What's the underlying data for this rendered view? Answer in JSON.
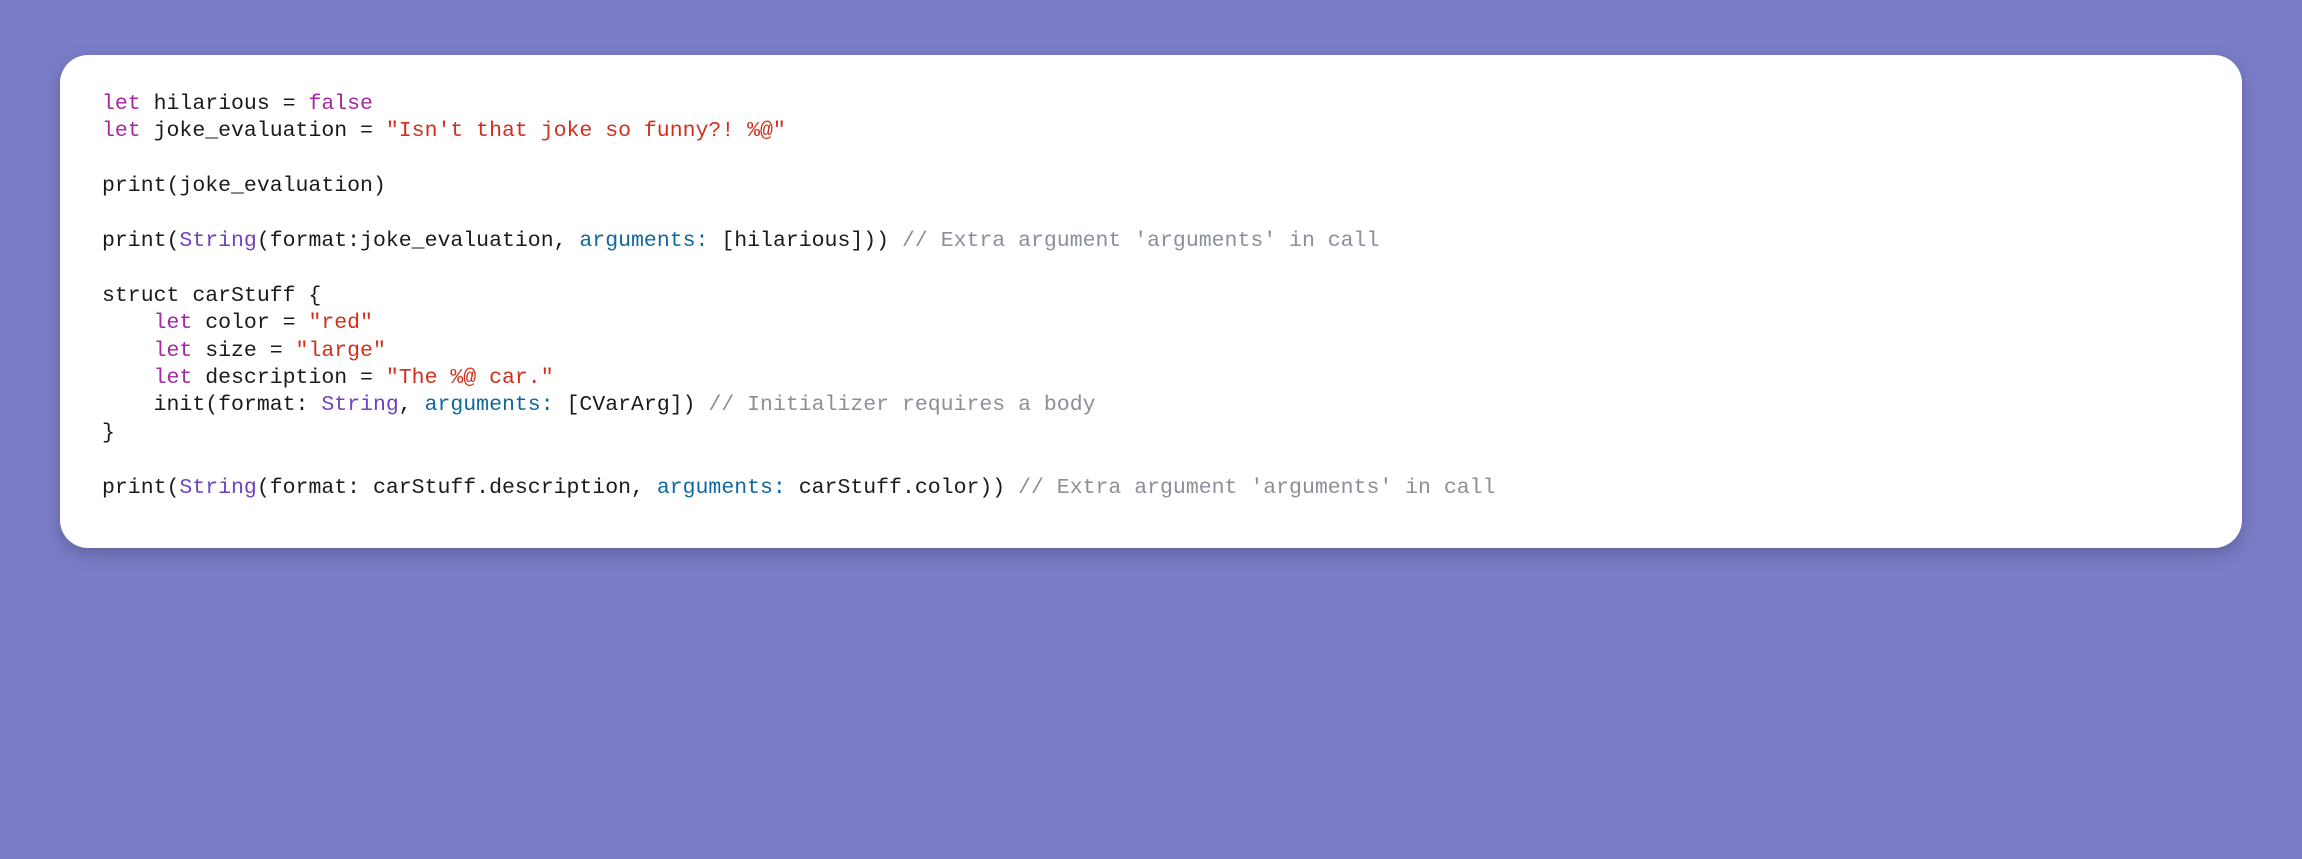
{
  "code": {
    "lines": [
      {
        "t1": "let",
        "t2": " hilarious = ",
        "t3": "false"
      },
      {
        "t1": "let",
        "t2": " joke_evaluation = ",
        "t3": "\"Isn't that joke so funny?! %@\""
      },
      {
        "blank": true
      },
      {
        "t2": "print(joke_evaluation)"
      },
      {
        "blank": true
      },
      {
        "t2a": "print(",
        "t2b": "String",
        "t2c": "(format:joke_evaluation, ",
        "t2d": "arguments:",
        "t2e": " [hilarious])) ",
        "t2f": "// Extra argument 'arguments' in call"
      },
      {
        "blank": true
      },
      {
        "t2": "struct carStuff {"
      },
      {
        "indent": "    ",
        "t1": "let",
        "t2": " color = ",
        "t3": "\"red\""
      },
      {
        "indent": "    ",
        "t1": "let",
        "t2": " size = ",
        "t3": "\"large\""
      },
      {
        "indent": "    ",
        "t1": "let",
        "t2": " description = ",
        "t3": "\"The %@ car.\""
      },
      {
        "indent": "    ",
        "t2a": "init(format: ",
        "t2b": "String",
        "t2c": ", ",
        "t2d": "arguments:",
        "t2e": " [CVarArg]) ",
        "t2f": "// Initializer requires a body"
      },
      {
        "t2": "}"
      },
      {
        "blank": true
      },
      {
        "t2a": "print(",
        "t2b": "String",
        "t2c": "(format: carStuff.description, ",
        "t2d": "arguments:",
        "t2e": " carStuff.color)) ",
        "t2f": "// Extra argument 'arguments' in call"
      }
    ]
  }
}
